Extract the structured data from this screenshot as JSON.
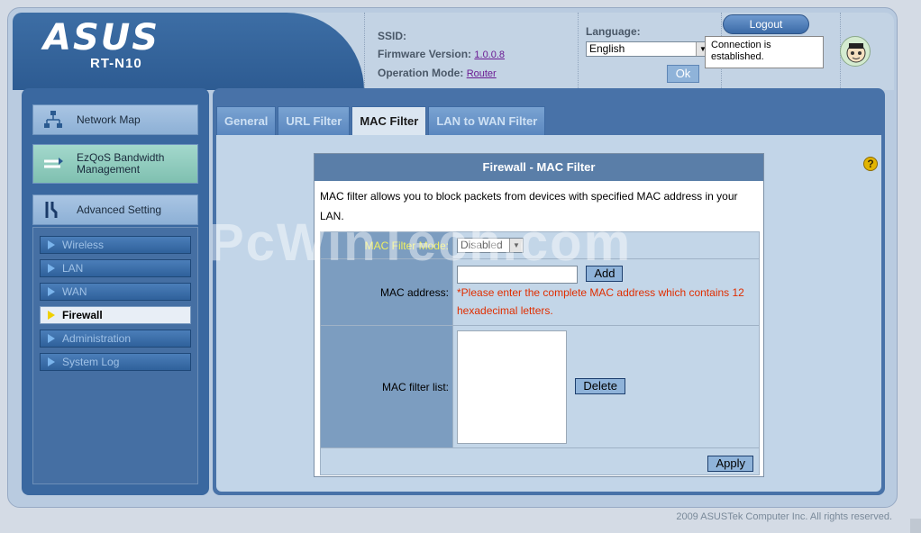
{
  "header": {
    "logo": "ASUS",
    "model": "RT-N10",
    "ssid_label": "SSID:",
    "ssid_value": "",
    "firmware_label": "Firmware Version:",
    "firmware_value": "1.0.0.8",
    "opmode_label": "Operation Mode:",
    "opmode_value": "Router",
    "language_label": "Language:",
    "language_value": "English",
    "ok_label": "Ok",
    "logout_label": "Logout",
    "status_bubble": "Connection is established."
  },
  "leftnav": {
    "network_map": "Network Map",
    "ezqos": "EzQoS Bandwidth Management",
    "advanced": "Advanced Setting",
    "submenu": [
      "Wireless",
      "LAN",
      "WAN",
      "Firewall",
      "Administration",
      "System Log"
    ],
    "active": "Firewall"
  },
  "tabs": [
    "General",
    "URL Filter",
    "MAC Filter",
    "LAN to WAN Filter"
  ],
  "active_tab": "MAC Filter",
  "panel": {
    "title": "Firewall - MAC Filter",
    "description": "MAC filter allows you to block packets from devices with specified MAC address in your LAN.",
    "mode_label": "MAC Filter Mode:",
    "mode_value": "Disabled",
    "mac_label": "MAC address:",
    "mac_value": "",
    "add_label": "Add",
    "mac_hint": "*Please enter the complete MAC address which contains 12 hexadecimal letters.",
    "list_label": "MAC filter list:",
    "delete_label": "Delete",
    "apply_label": "Apply"
  },
  "watermark": "PcWinTech.com",
  "footer": "2009 ASUSTek Computer Inc. All rights reserved.",
  "colors": {
    "accent": "#3a68a0",
    "warning": "#e02e00"
  }
}
